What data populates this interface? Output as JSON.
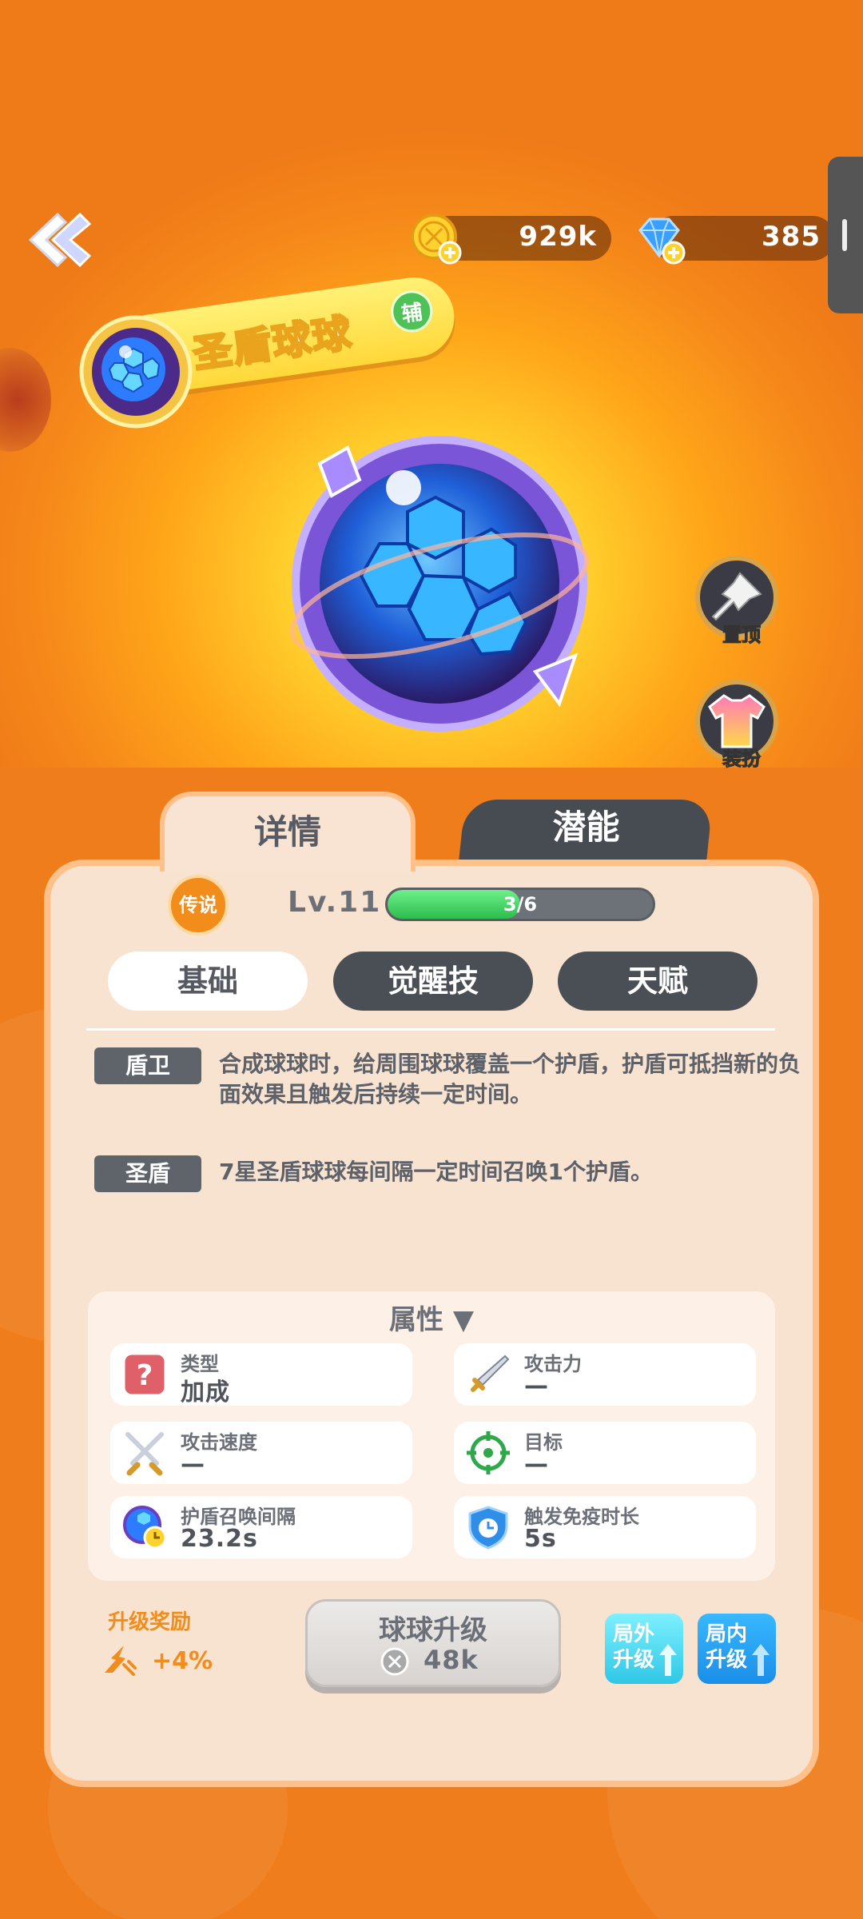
{
  "topbar": {
    "gold_amount": "929k",
    "gem_amount": "385"
  },
  "ball": {
    "name": "圣盾球球",
    "role_badge": "辅"
  },
  "side_buttons": {
    "pin_label": "置顶",
    "skin_label": "装扮"
  },
  "tabs": {
    "details": "详情",
    "potential": "潜能"
  },
  "info": {
    "rarity": "传说",
    "level": "Lv.11",
    "xp_text": "3/6",
    "xp_progress": 0.5
  },
  "subtabs": {
    "basic": "基础",
    "awaken": "觉醒技",
    "talent": "天赋"
  },
  "skills": [
    {
      "tag": "盾卫",
      "desc": "合成球球时，给周围球球覆盖一个护盾，护盾可抵挡新的负面效果且触发后持续一定时间。"
    },
    {
      "tag": "圣盾",
      "desc": "7星圣盾球球每间隔一定时间召唤1个护盾。"
    }
  ],
  "attributes": {
    "title": "属性",
    "items": [
      {
        "key": "类型",
        "value": "加成",
        "icon": "question-icon"
      },
      {
        "key": "攻击力",
        "value": "—",
        "icon": "sword-icon"
      },
      {
        "key": "攻击速度",
        "value": "—",
        "icon": "crossed-swords-icon"
      },
      {
        "key": "目标",
        "value": "—",
        "icon": "target-icon"
      },
      {
        "key": "护盾召唤间隔",
        "value": "23.2s",
        "icon": "ball-clock-icon"
      },
      {
        "key": "触发免疫时长",
        "value": "5s",
        "icon": "shield-clock-icon"
      }
    ]
  },
  "upgrade": {
    "reward_title": "升级奖励",
    "reward_value": "+4%",
    "button_label": "球球升级",
    "cost": "48k",
    "out_game_label": "局外升级",
    "in_game_label": "局内升级"
  },
  "colors": {
    "accent_orange": "#f28c1b",
    "panel_bg": "#f8e2d0",
    "dark_tab": "#474b52",
    "xp_green": "#2dbd4d"
  }
}
